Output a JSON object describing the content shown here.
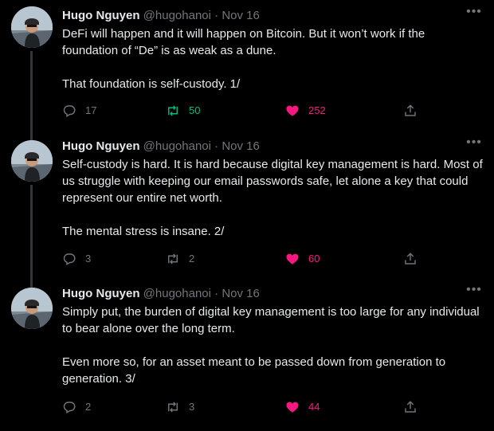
{
  "tweets": [
    {
      "name": "Hugo Nguyen",
      "handle": "@hugohanoi",
      "date": "Nov 16",
      "paragraphs": [
        "DeFi will happen and it will happen on Bitcoin. But it won’t work if the foundation of “De” is as weak as a dune.",
        "That foundation is self-custody. 1/"
      ],
      "replies": "17",
      "retweets": "50",
      "likes": "252",
      "retweeted": true,
      "liked": true
    },
    {
      "name": "Hugo Nguyen",
      "handle": "@hugohanoi",
      "date": "Nov 16",
      "paragraphs": [
        "Self-custody is hard. It is hard because digital key management is hard. Most of us struggle with keeping our email passwords safe, let alone a key that could represent our entire net worth.",
        "The mental stress is insane. 2/"
      ],
      "replies": "3",
      "retweets": "2",
      "likes": "60",
      "retweeted": false,
      "liked": true
    },
    {
      "name": "Hugo Nguyen",
      "handle": "@hugohanoi",
      "date": "Nov 16",
      "paragraphs": [
        "Simply put, the burden of digital key management is too large for any individual to bear alone over the long term.",
        "Even more so, for an asset meant to be passed down from generation to generation. 3/"
      ],
      "replies": "2",
      "retweets": "3",
      "likes": "44",
      "retweeted": false,
      "liked": true
    }
  ],
  "colors": {
    "background": "#000000",
    "text": "#e7e9ea",
    "muted": "#71767b",
    "retweet_active": "#00ba7c",
    "like_active": "#f91880"
  }
}
